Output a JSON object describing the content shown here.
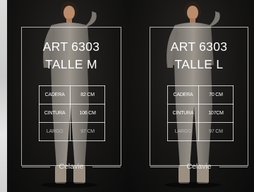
{
  "panels": [
    {
      "art": "ART 6303",
      "talle": "TALLE M",
      "rows": [
        {
          "label": "CADERA",
          "value": "82 CM"
        },
        {
          "label": "CINTURA",
          "value": "106 CM"
        },
        {
          "label": "LARGO",
          "value": "97 CM"
        }
      ],
      "brand": "Celavie"
    },
    {
      "art": "ART 6303",
      "talle": "TALLE L",
      "rows": [
        {
          "label": "CADERA",
          "value": "70 CM"
        },
        {
          "label": "CINTURA",
          "value": "107CM"
        },
        {
          "label": "LARGO",
          "value": "97 CM"
        }
      ],
      "brand": "Celavie"
    }
  ]
}
